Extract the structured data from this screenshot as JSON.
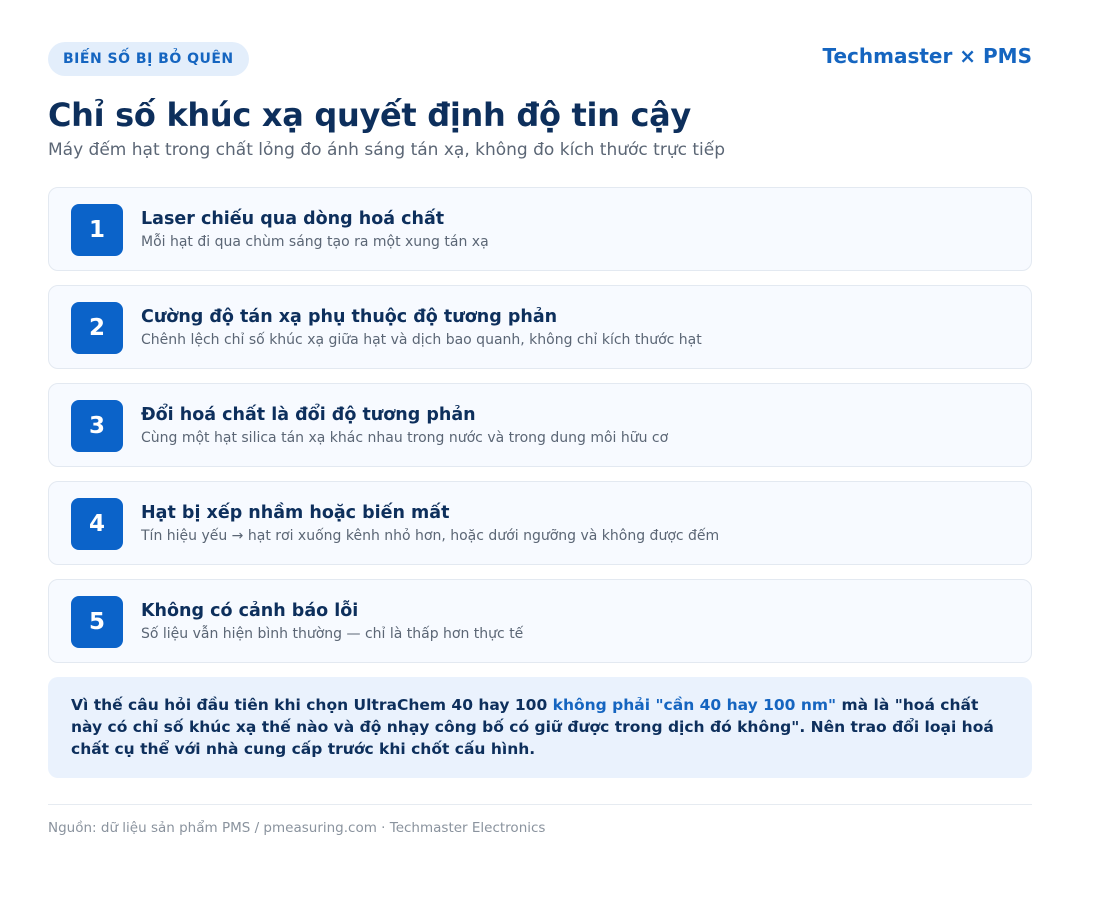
{
  "header": {
    "tag": "BIẾN SỐ BỊ BỎ QUÊN",
    "brand": "Techmaster × PMS",
    "title": "Chỉ số khúc xạ quyết định độ tin cậy",
    "subtitle": "Máy đếm hạt trong chất lỏng đo ánh sáng tán xạ, không đo kích thước trực tiếp"
  },
  "steps": [
    {
      "number": "1",
      "title": "Laser chiếu qua dòng hoá chất",
      "description": "Mỗi hạt đi qua chùm sáng tạo ra một xung tán xạ"
    },
    {
      "number": "2",
      "title": "Cường độ tán xạ phụ thuộc độ tương phản",
      "description": "Chênh lệch chỉ số khúc xạ giữa hạt và dịch bao quanh, không chỉ kích thước hạt"
    },
    {
      "number": "3",
      "title": "Đổi hoá chất là đổi độ tương phản",
      "description": "Cùng một hạt silica tán xạ khác nhau trong nước và trong dung môi hữu cơ"
    },
    {
      "number": "4",
      "title": "Hạt bị xếp nhầm hoặc biến mất",
      "description": "Tín hiệu yếu → hạt rơi xuống kênh nhỏ hơn, hoặc dưới ngưỡng và không được đếm"
    },
    {
      "number": "5",
      "title": "Không có cảnh báo lỗi",
      "description": "Số liệu vẫn hiện bình thường — chỉ là thấp hơn thực tế"
    }
  ],
  "note": {
    "before": "Vì thế câu hỏi đầu tiên khi chọn UltraChem 40 hay 100 ",
    "highlight": "không phải \"cần 40 hay 100 nm\"",
    "after": " mà là \"hoá chất này có chỉ số khúc xạ thế nào và độ nhạy công bố có giữ được trong dịch đó không\". Nên trao đổi loại hoá chất cụ thể với nhà cung cấp trước khi chốt cấu hình."
  },
  "footer": {
    "source": "Nguồn: dữ liệu sản phẩm PMS / pmeasuring.com · Techmaster Electronics"
  },
  "colors": {
    "primary": "#0b63c9",
    "accent": "#1565c0",
    "heading": "#0d2f5c",
    "muted": "#5b6675",
    "card_bg": "#f7faff",
    "note_bg": "#eaf2fd"
  }
}
